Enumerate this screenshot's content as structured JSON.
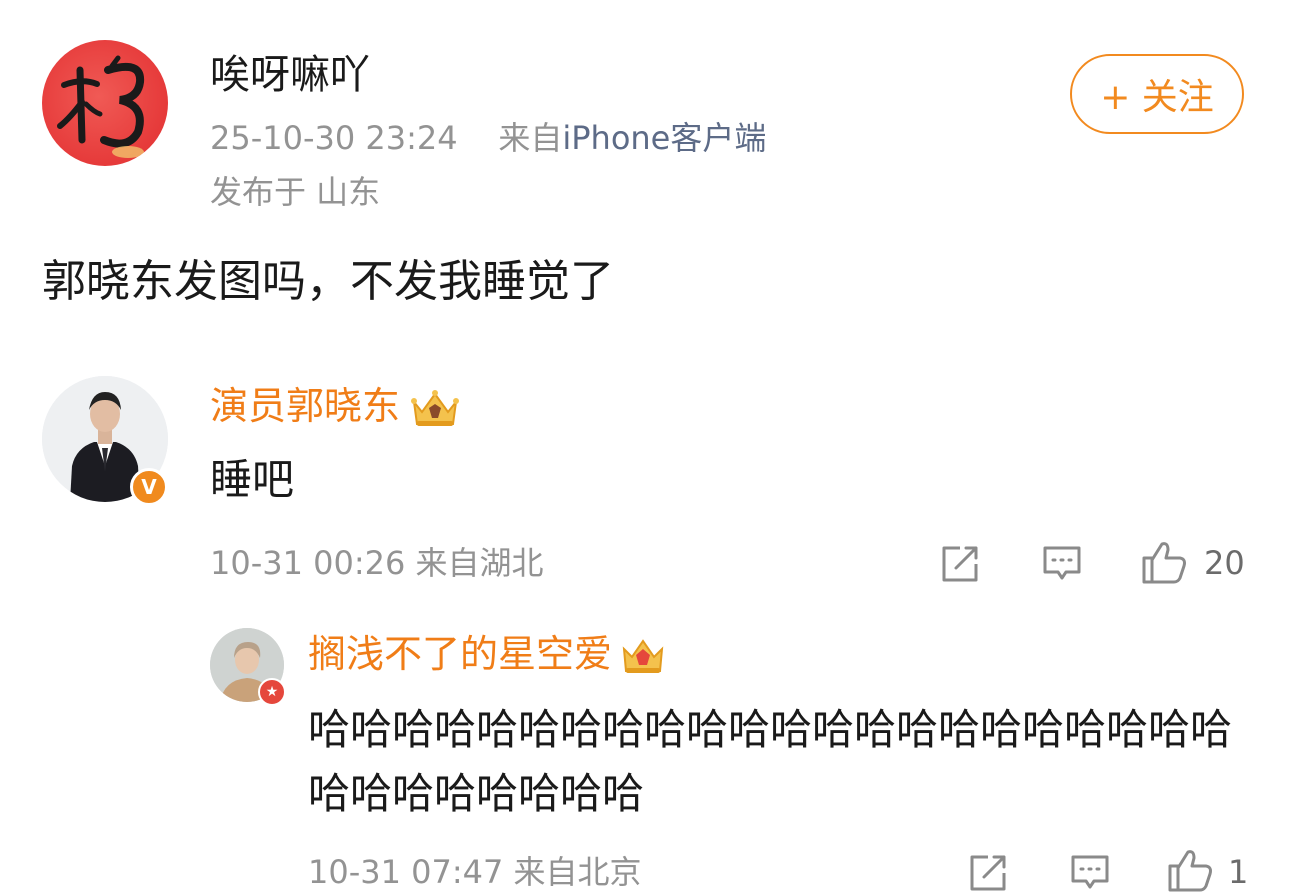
{
  "post": {
    "author": "唉呀嘛吖",
    "datetime": "25-10-30 23:24",
    "source_prefix": "来自",
    "device": "iPhone客户端",
    "location": "发布于 山东",
    "follow_label": "+ 关注",
    "text": "郭晓东发图吗，不发我睡觉了"
  },
  "comments": [
    {
      "author": "演员郭晓东",
      "text": "睡吧",
      "meta": "10-31 00:26 来自湖北",
      "like_count": "20",
      "verified_badge": "V"
    }
  ],
  "replies": [
    {
      "author": "搁浅不了的星空爱",
      "text": "哈哈哈哈哈哈哈哈哈哈哈哈哈哈哈哈哈哈哈哈哈哈哈哈哈哈哈哈哈哈",
      "meta": "10-31 07:47 来自北京",
      "like_count": "1"
    }
  ],
  "icons": {
    "share": "share-icon",
    "comment": "comment-icon",
    "like": "thumbs-up-icon",
    "crown": "crown-icon"
  },
  "colors": {
    "accent_orange": "#f28a1f",
    "meta_gray": "#939393",
    "device_blue": "#5d6b87",
    "avatar_red": "#e63a3a"
  }
}
